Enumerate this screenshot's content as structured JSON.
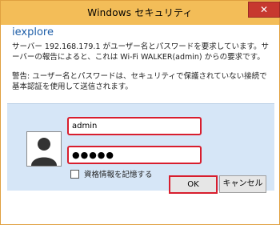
{
  "window": {
    "title": "Windows セキュリティ",
    "close_glyph": "✕"
  },
  "dialog": {
    "app_name": "iexplore",
    "message1": "サーバー 192.168.179.1 がユーザー名とパスワードを要求しています。サーバーの報告によると、これは Wi-Fi WALKER(admin) からの要求です。",
    "message2": "警告: ユーザー名とパスワードは、セキュリティで保護されていない接続で基本認証を使用して送信されます。"
  },
  "credentials": {
    "username_value": "admin",
    "password_value": "●●●●●",
    "remember_label": "資格情報を記憶する",
    "remember_checked": false
  },
  "buttons": {
    "ok_label": "OK",
    "cancel_label": "キャンセル"
  },
  "colors": {
    "titlebar": "#f3bd58",
    "app_name": "#1f5fa8",
    "panel": "#d6e6f7",
    "highlight": "#d81e2e",
    "close": "#c7382f"
  },
  "icons": {
    "avatar": "user-avatar-icon",
    "close": "close-icon",
    "checkbox": "checkbox-icon"
  }
}
